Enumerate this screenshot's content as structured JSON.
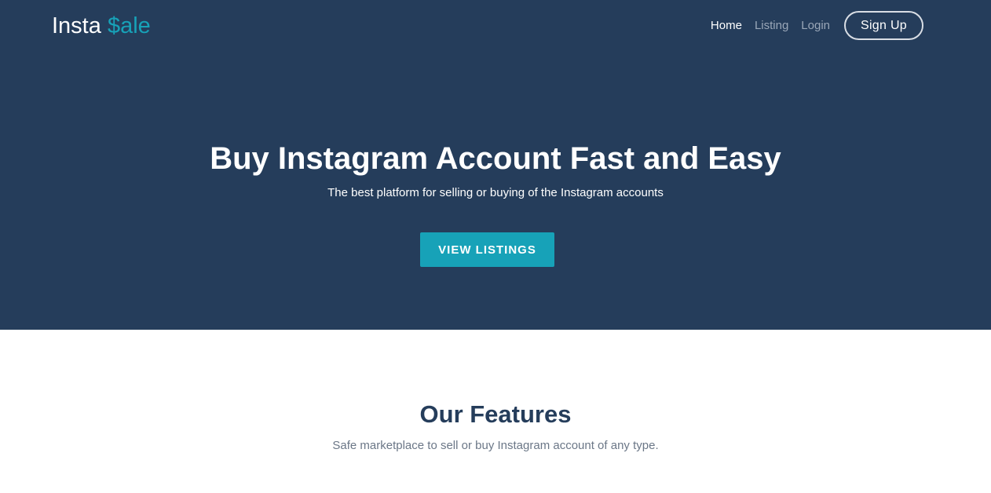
{
  "brand": {
    "name_main": "Insta ",
    "name_accent": "$ale",
    "accent_color": "#17a2b8"
  },
  "nav": {
    "items": [
      {
        "label": "Home",
        "active": true
      },
      {
        "label": "Listing",
        "active": false
      },
      {
        "label": "Login",
        "active": false
      }
    ],
    "signup_label": "Sign Up"
  },
  "hero": {
    "title": "Buy Instagram Account Fast and Easy",
    "subtitle": "The best platform for selling or buying of the Instagram accounts",
    "cta_label": "VIEW LISTINGS",
    "background_color": "#253d5b"
  },
  "features": {
    "title": "Our Features",
    "subtitle": "Safe marketplace to sell or buy Instagram account of any type."
  }
}
